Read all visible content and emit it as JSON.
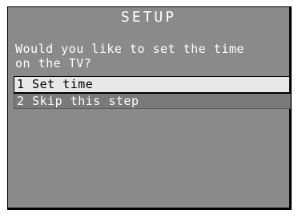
{
  "screen": {
    "title": "SETUP",
    "prompt_line1": "Would you like to set the time",
    "prompt_line2": "on the TV?"
  },
  "menu": {
    "items": [
      {
        "label": "1 Set time",
        "selected": true
      },
      {
        "label": "2 Skip this step",
        "selected": false
      }
    ]
  },
  "colors": {
    "background": "#8a8a8a",
    "selected_item": "#e8e8e8",
    "item": "#7a7a7a",
    "text": "#ffffff"
  }
}
